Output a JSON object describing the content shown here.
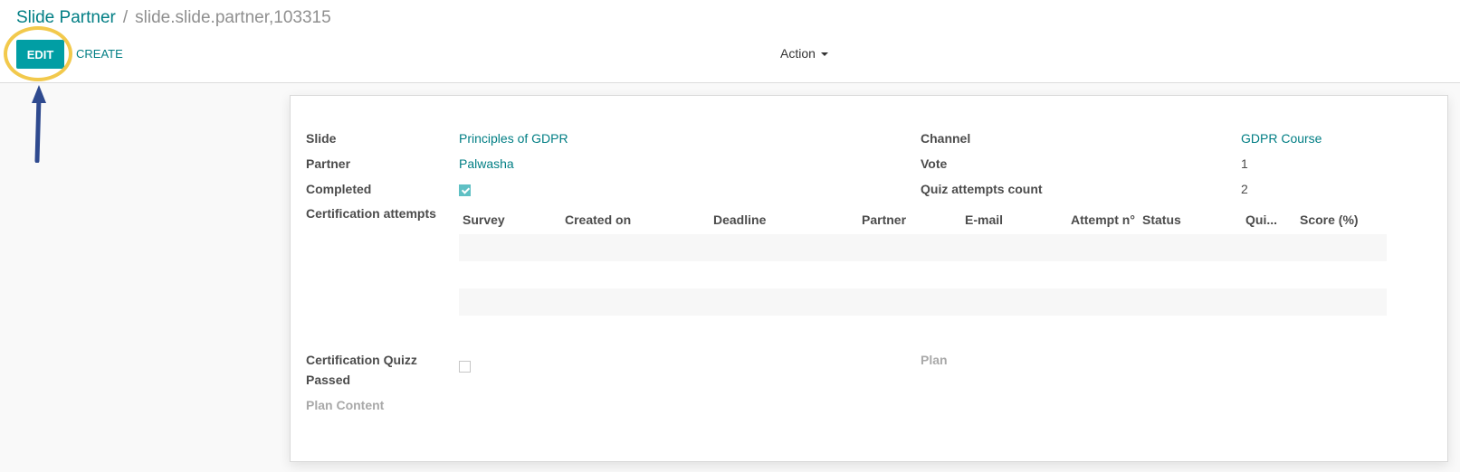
{
  "breadcrumb": {
    "parent": "Slide Partner",
    "separator": "/",
    "current": "slide.slide.partner,103315"
  },
  "toolbar": {
    "edit_label": "EDIT",
    "create_label": "CREATE",
    "action_label": "Action"
  },
  "annotation": {
    "ring_color": "#f2c94c",
    "arrow_color": "#2f4a8f"
  },
  "form": {
    "slide_label": "Slide",
    "slide_value": "Principles of GDPR",
    "partner_label": "Partner",
    "partner_value": "Palwasha",
    "completed_label": "Completed",
    "completed_checked": true,
    "cert_attempts_label": "Certification attempts",
    "channel_label": "Channel",
    "channel_value": "GDPR Course",
    "vote_label": "Vote",
    "vote_value": "1",
    "quiz_attempts_label": "Quiz attempts count",
    "quiz_attempts_value": "2",
    "cert_quiz_label_line1": "Certification Quizz",
    "cert_quiz_label_line2": "Passed",
    "cert_quiz_checked": false,
    "plan_label": "Plan",
    "plan_content_label": "Plan Content"
  },
  "attempts_table": {
    "columns": [
      "Survey",
      "Created on",
      "Deadline",
      "Partner",
      "E-mail",
      "Attempt n°",
      "Status",
      "Qui...",
      "Score (%)"
    ],
    "rows": []
  },
  "colors": {
    "primary": "#019ea4",
    "link": "#017e84",
    "muted": "#a9a9a9"
  }
}
